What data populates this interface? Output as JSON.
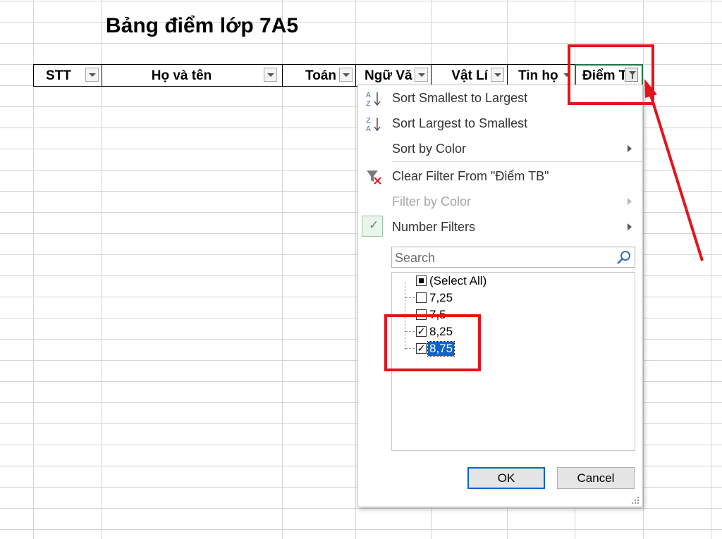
{
  "sheet": {
    "title": "Bảng điểm lớp 7A5"
  },
  "table": {
    "headers": [
      {
        "label": "STT"
      },
      {
        "label": "Họ và tên"
      },
      {
        "label": "Toán"
      },
      {
        "label": "Ngữ Vă"
      },
      {
        "label": "Vật Lí"
      },
      {
        "label": "Tin họ"
      },
      {
        "label": "Điểm T",
        "filtered": true
      }
    ]
  },
  "filter_menu": {
    "items": [
      {
        "label": "Sort Smallest to Largest",
        "icon": "sort-ascending-icon",
        "enabled": true
      },
      {
        "label": "Sort Largest to Smallest",
        "icon": "sort-descending-icon",
        "enabled": true
      },
      {
        "label": "Sort by Color",
        "submenu": true,
        "enabled": true
      },
      {
        "label": "Clear Filter From \"Điểm TB\"",
        "icon": "clear-filter-icon",
        "enabled": true
      },
      {
        "label": "Filter by Color",
        "submenu": true,
        "enabled": false
      },
      {
        "label": "Number Filters",
        "submenu": true,
        "checked": true,
        "enabled": true
      }
    ],
    "search_placeholder": "Search",
    "values": [
      {
        "label": "(Select All)",
        "state": "partial"
      },
      {
        "label": "7,25",
        "state": "unchecked"
      },
      {
        "label": "7,5",
        "state": "unchecked"
      },
      {
        "label": "8,25",
        "state": "checked"
      },
      {
        "label": "8,75",
        "state": "checked",
        "selected": true
      }
    ],
    "ok_label": "OK",
    "cancel_label": "Cancel"
  },
  "colors": {
    "accent_blue": "#0a64c8",
    "annotation_red": "#e3141b",
    "active_cell_green": "#217346"
  }
}
